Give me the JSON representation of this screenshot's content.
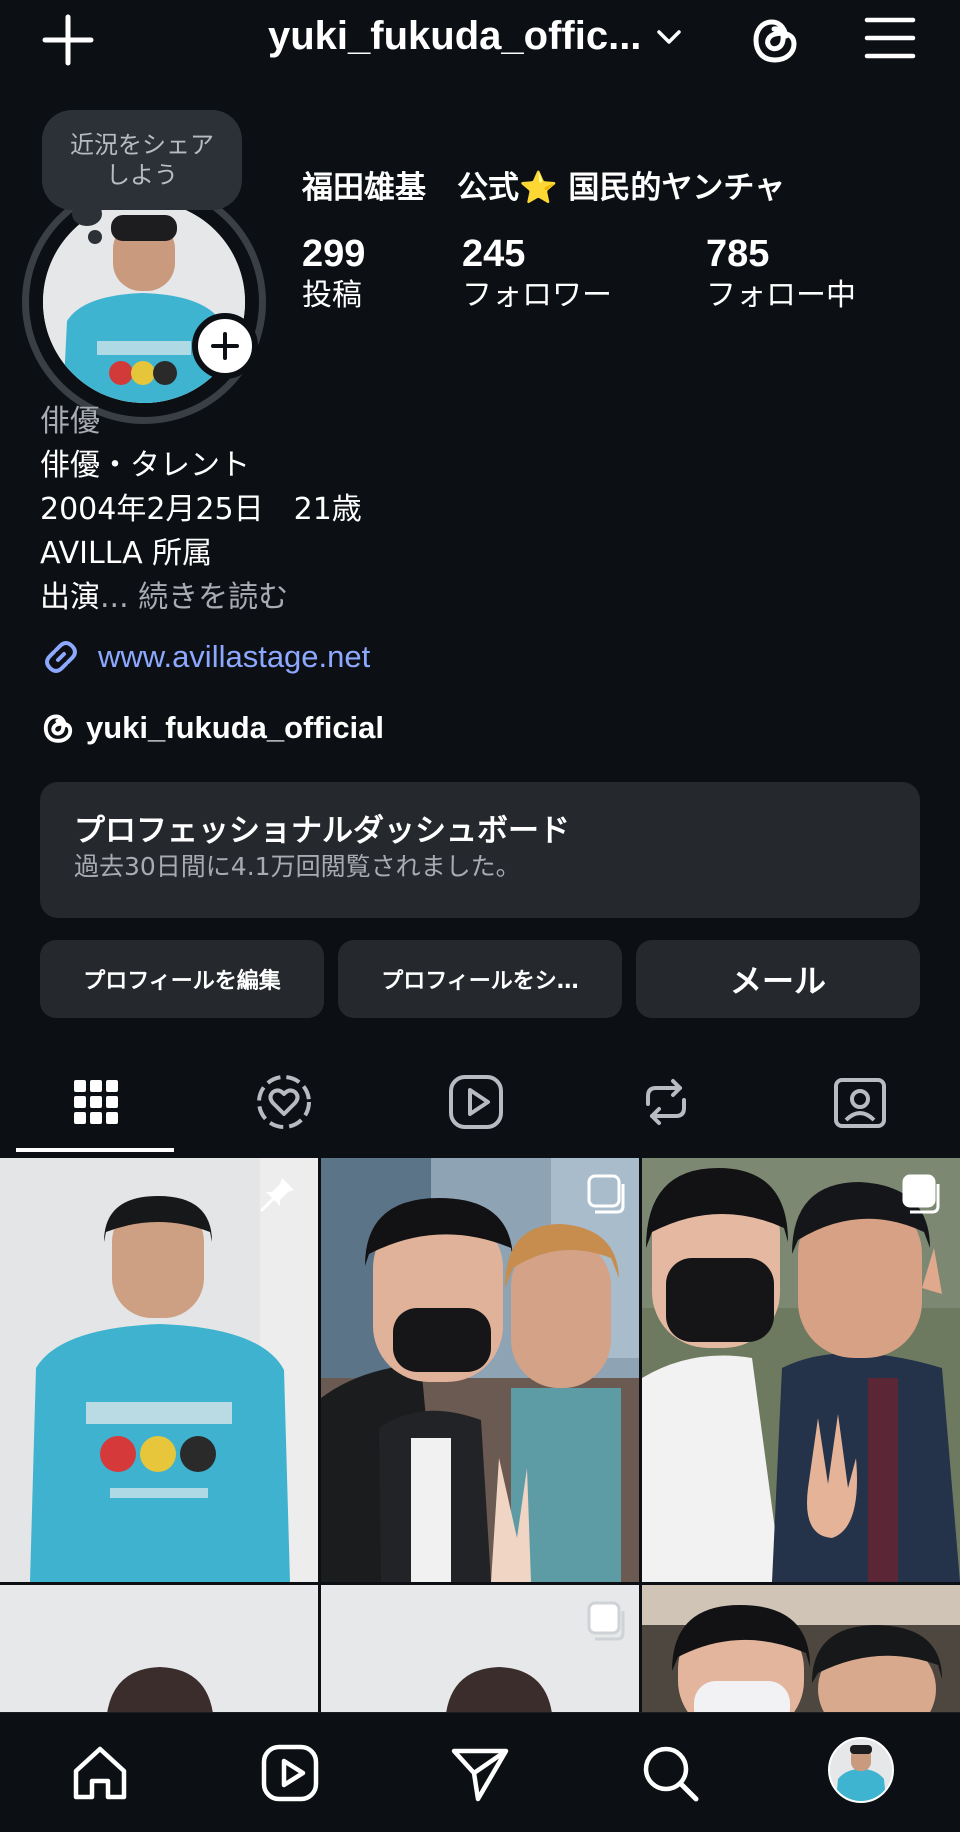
{
  "header": {
    "username": "yuki_fukuda_offic...",
    "icons": {
      "new": "plus-icon",
      "switch": "chevron-down-icon",
      "threads": "threads-icon",
      "menu": "hamburger-menu-icon"
    }
  },
  "profile": {
    "note": {
      "line1": "近況をシェア",
      "line2": "しよう"
    },
    "display_name": "福田雄基　公式⭐️ 国民的ヤンチャ",
    "stats": [
      {
        "value": "299",
        "label": "投稿"
      },
      {
        "value": "245",
        "label": "フォロワー"
      },
      {
        "value": "785",
        "label": "フォロー中"
      }
    ],
    "bio": {
      "category": "俳優",
      "lines": [
        "俳優・タレント",
        "2004年2月25日　21歳",
        "AVILLA 所属"
      ],
      "last_line": "出演",
      "more": "... 続きを読む"
    },
    "link": "www.avillastage.net",
    "threads_handle": "yuki_fukuda_official"
  },
  "dashboard": {
    "title": "プロフェッショナルダッシュボード",
    "subtitle": "過去30日間に4.1万回閲覧されました。"
  },
  "buttons": {
    "edit": "プロフィールを編集",
    "share": "プロフィールをシ…",
    "email": "メール"
  },
  "tabs": [
    "grid-icon",
    "liked-icon",
    "reels-icon",
    "reposts-icon",
    "tagged-icon"
  ],
  "colors": {
    "background": "#0c1014",
    "surface": "#25292e",
    "link": "#8da8ff",
    "muted": "#a8acb2"
  },
  "bottom_nav": [
    "home-icon",
    "reels-icon",
    "send-icon",
    "search-icon",
    "profile-avatar"
  ]
}
